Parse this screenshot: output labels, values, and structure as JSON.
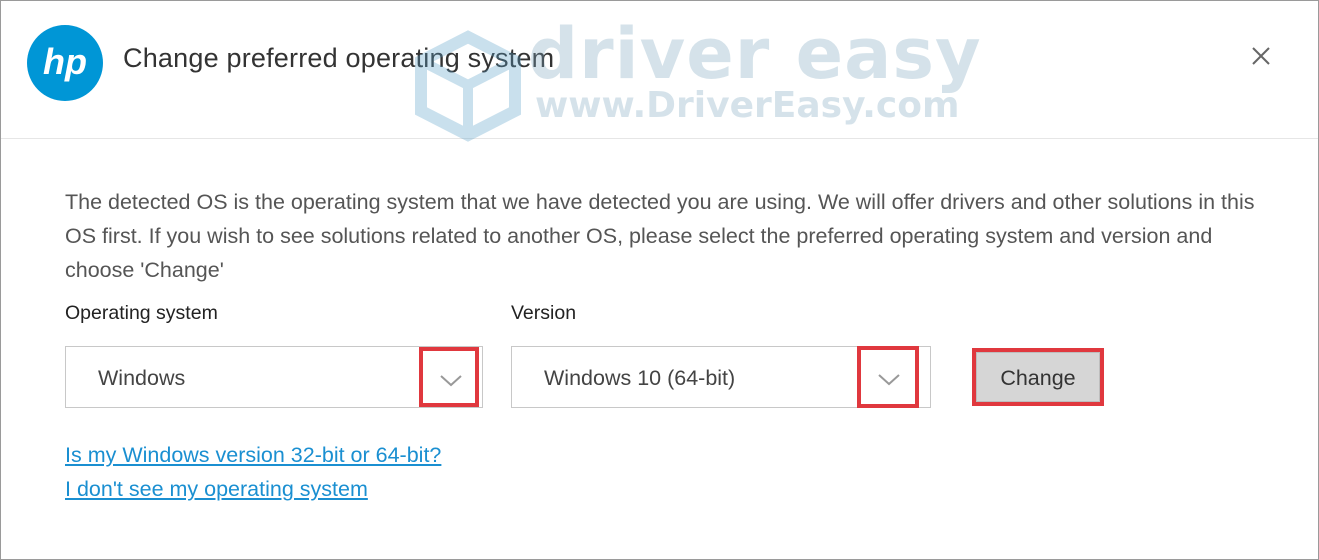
{
  "dialog": {
    "title": "Change preferred operating system",
    "description": "The detected OS is the operating system that we have detected you are using. We will offer drivers and other solutions in this OS first. If you wish to see solutions related to another OS, please select the preferred operating system and version and choose 'Change'"
  },
  "watermark": {
    "brand": "driver easy",
    "url": "www.DriverEasy.com"
  },
  "form": {
    "os_label": "Operating system",
    "os_value": "Windows",
    "version_label": "Version",
    "version_value": "Windows 10 (64-bit)",
    "change_label": "Change"
  },
  "links": {
    "bitness": "Is my Windows version 32-bit or 64-bit?",
    "missing_os": "I don't see my operating system"
  },
  "colors": {
    "hp_blue": "#0096d6",
    "highlight_red": "#e0383e",
    "link_blue": "#1a8fd1"
  },
  "icons": {
    "logo": "hp-logo",
    "close": "close-icon",
    "dropdown": "chevron-down-icon"
  }
}
